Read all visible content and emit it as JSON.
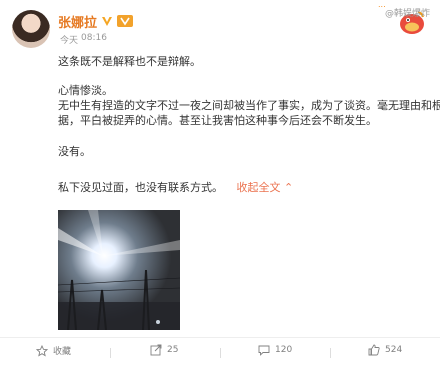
{
  "post": {
    "author": "张娜拉",
    "time": {
      "day": "今天",
      "clock": "08:16"
    },
    "menu_badge": "...",
    "paragraphs": [
      "这条既不是解释也不是辩解。",
      "心情惨淡。",
      "无中生有捏造的文字不过一夜之间却被当作了事实，成为了谈资。毫无理由和根",
      "据，平白被捉弄的心情。甚至让我害怕这种事今后还会不断发生。",
      "没有。",
      "私下没见过面，也没有联系方式。"
    ],
    "collapse_label": "收起全文",
    "collapse_arrow": "⌃"
  },
  "actions": {
    "favorite_label": "收藏",
    "repost_count": "25",
    "comment_count": "120",
    "like_count": "524"
  },
  "watermark": "@韩娱爆炸",
  "icons": [
    "verified-icon",
    "vip-icon",
    "weibo-logo-icon",
    "star-icon",
    "repost-icon",
    "comment-icon",
    "like-icon"
  ],
  "colors": {
    "author": "#e67a23",
    "collapse": "#eb7350",
    "muted": "#808080"
  }
}
